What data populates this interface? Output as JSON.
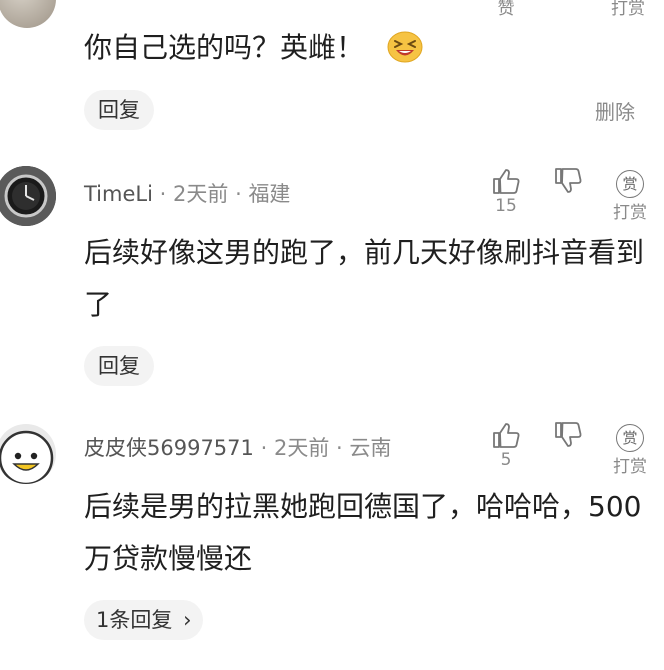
{
  "comments": [
    {
      "text": "你自己选的吗？英雌！",
      "reply_label": "回复",
      "top_like_label": "赞",
      "top_tip_label": "打赏",
      "delete_label": "删除"
    },
    {
      "username": "TimeLi",
      "time": "2天前",
      "location": "福建",
      "text": "后续好像这男的跑了，前几天好像刷抖音看到了",
      "like_count": "15",
      "tip_label": "打赏",
      "tip_icon_char": "赏",
      "reply_label": "回复"
    },
    {
      "username": "皮皮侠56997571",
      "time": "2天前",
      "location": "云南",
      "text": "后续是男的拉黑她跑回德国了，哈哈哈，500万贷款慢慢还",
      "like_count": "5",
      "tip_label": "打赏",
      "tip_icon_char": "赏",
      "replies_label": "1条回复",
      "replies_chevron": "›"
    }
  ],
  "separator": "·"
}
